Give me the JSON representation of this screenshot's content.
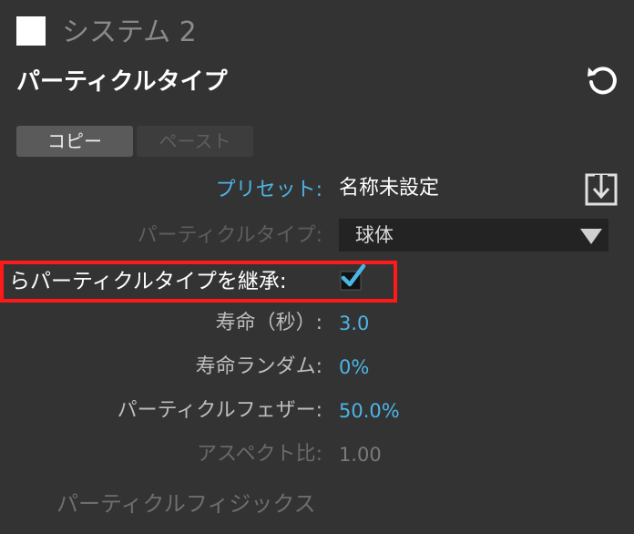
{
  "header": {
    "system_title": "システム 2",
    "section_title": "パーティクルタイプ"
  },
  "actions": {
    "copy_label": "コピー",
    "paste_label": "ペースト"
  },
  "preset": {
    "label": "プリセット:",
    "value": "名称未設定"
  },
  "particle_type": {
    "label": "パーティクルタイプ:",
    "selected": "球体"
  },
  "inherit": {
    "label": "らパーティクルタイプを継承:",
    "checked": true
  },
  "lifespan": {
    "label": "寿命（秒）:",
    "value": "3.0"
  },
  "lifespan_random": {
    "label": "寿命ランダム:",
    "value": "0%"
  },
  "feather": {
    "label": "パーティクルフェザー:",
    "value": "50.0%"
  },
  "aspect": {
    "label": "アスペクト比:",
    "value": "1.00"
  },
  "physics": {
    "title": "パーティクルフィジックス"
  },
  "colors": {
    "background": "#333333",
    "accent": "#4bb5e6",
    "highlight": "#ff1a1a"
  },
  "icons": [
    "reset-icon",
    "save-preset-icon",
    "dropdown-arrow-icon",
    "checkmark-icon"
  ]
}
